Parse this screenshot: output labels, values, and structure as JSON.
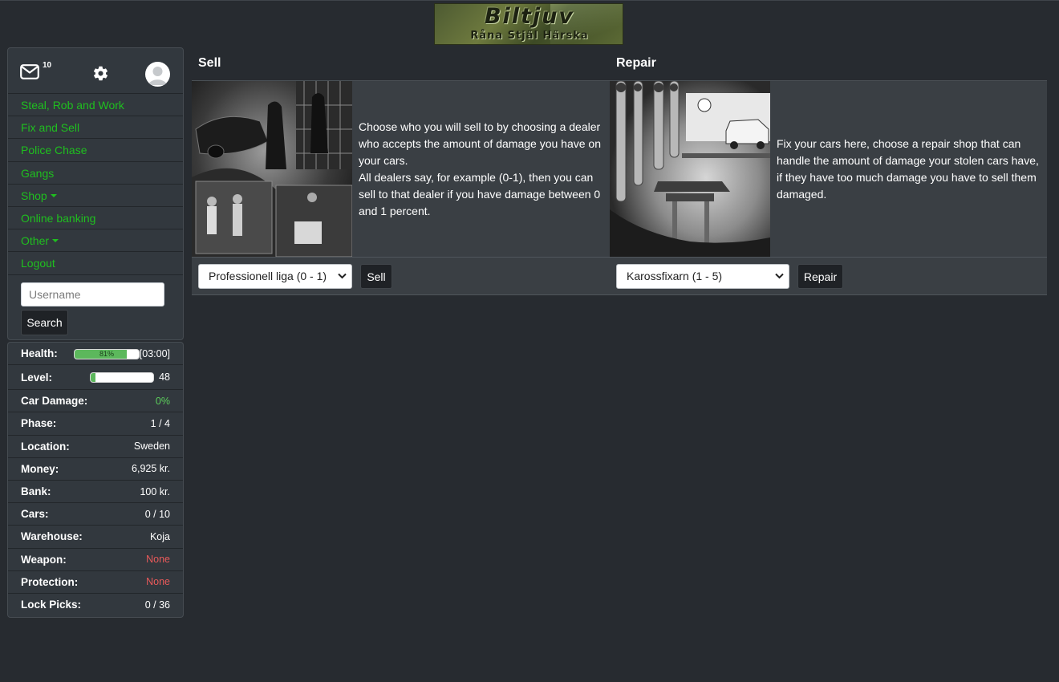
{
  "logo": {
    "title": "Biltjuv",
    "subtitle": "Råna Stjäl Härska"
  },
  "header": {
    "mail_count": "10"
  },
  "nav": {
    "steal": "Steal, Rob and Work",
    "fix_sell": "Fix and Sell",
    "police": "Police Chase",
    "gangs": "Gangs",
    "shop": "Shop",
    "banking": "Online banking",
    "other": "Other",
    "logout": "Logout"
  },
  "search": {
    "placeholder": "Username",
    "button": "Search"
  },
  "stats": {
    "health": {
      "label": "Health:",
      "percent": 81,
      "percent_text": "81%",
      "timer": "[03:00]"
    },
    "level": {
      "label": "Level:",
      "progress": 0.08,
      "value": "48"
    },
    "car_damage": {
      "label": "Car Damage:",
      "value": "0%"
    },
    "phase": {
      "label": "Phase:",
      "value": "1 / 4"
    },
    "location": {
      "label": "Location:",
      "value": "Sweden"
    },
    "money": {
      "label": "Money:",
      "value": "6,925 kr."
    },
    "bank": {
      "label": "Bank:",
      "value": "100 kr."
    },
    "cars": {
      "label": "Cars:",
      "value": "0 / 10"
    },
    "warehouse": {
      "label": "Warehouse:",
      "value": "Koja"
    },
    "weapon": {
      "label": "Weapon:",
      "value": "None"
    },
    "protection": {
      "label": "Protection:",
      "value": "None"
    },
    "lockpicks": {
      "label": "Lock Picks:",
      "value": "0 / 36"
    }
  },
  "sell": {
    "title": "Sell",
    "text1": "Choose who you will sell to by choosing a dealer who accepts the amount of damage you have on your cars.",
    "text2": "All dealers say, for example (0-1), then you can sell to that dealer if you have damage between 0 and 1 percent.",
    "select_value": "Professionell liga (0 - 1)",
    "button": "Sell"
  },
  "repair": {
    "title": "Repair",
    "text": "Fix your cars here, choose a repair shop that can handle the amount of damage your stolen cars have, if they have too much damage you have to sell them damaged.",
    "select_value": "Karossfixarn (1 - 5)",
    "button": "Repair"
  },
  "colors": {
    "link_green": "#1fbf1f",
    "bg": "#272b30",
    "panel": "#3a3f44",
    "danger": "#e85a5a",
    "success": "#5cb85c"
  }
}
